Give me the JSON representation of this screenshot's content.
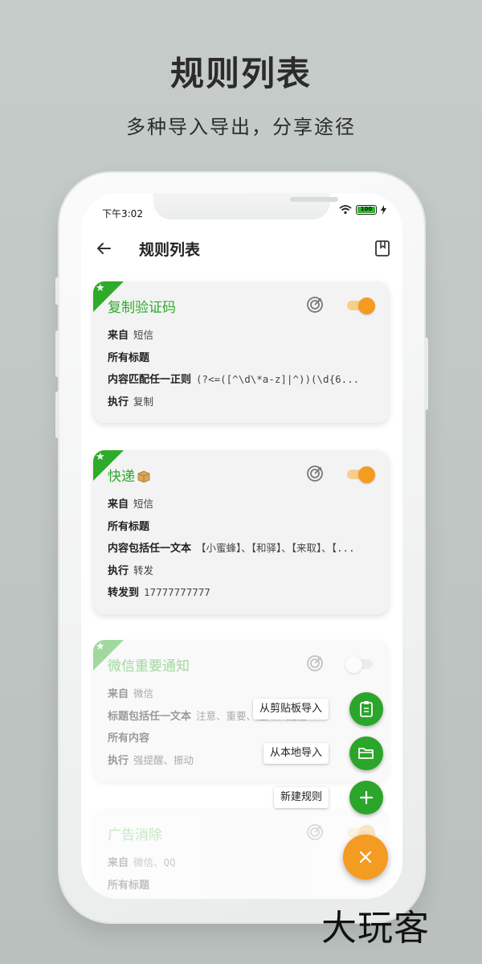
{
  "promo": {
    "title": "规则列表",
    "subtitle": "多种导入导出，分享途径"
  },
  "status": {
    "time": "下午3:02",
    "battery": "100"
  },
  "topbar": {
    "title": "规则列表"
  },
  "rules": [
    {
      "title": "复制验证码",
      "enabled": true,
      "rows": [
        {
          "label": "来自",
          "value": "短信"
        },
        {
          "label": "所有标题",
          "value": ""
        },
        {
          "label": "内容匹配任一正则",
          "value": "(?<=([^\\d\\*a-z]|^))(\\d{6..."
        },
        {
          "label": "执行",
          "value": "复制"
        }
      ]
    },
    {
      "title": "快递",
      "enabled": true,
      "rows": [
        {
          "label": "来自",
          "value": "短信"
        },
        {
          "label": "所有标题",
          "value": ""
        },
        {
          "label": "内容包括任一文本",
          "value": "【小蜜蜂】、【和驿】、【来取】、【..."
        },
        {
          "label": "执行",
          "value": "转发"
        },
        {
          "label": "转发到",
          "value": "17777777777"
        }
      ]
    },
    {
      "title": "微信重要通知",
      "enabled": false,
      "rows": [
        {
          "label": "来自",
          "value": "微信"
        },
        {
          "label": "标题包括任一文本",
          "value": "注意、重要、通知、提醒"
        },
        {
          "label": "所有内容",
          "value": ""
        },
        {
          "label": "执行",
          "value": "强提醒、振动"
        }
      ]
    },
    {
      "title": "广告消除",
      "enabled": true,
      "rows": [
        {
          "label": "来自",
          "value": "微信、QQ"
        },
        {
          "label": "所有标题",
          "value": ""
        }
      ]
    }
  ],
  "fab": {
    "clipboard_label": "从剪贴板导入",
    "local_label": "从本地导入",
    "new_label": "新建规则"
  },
  "watermark": "大玩客",
  "colors": {
    "accent_green": "#2eab2a",
    "accent_orange": "#f49b21"
  }
}
